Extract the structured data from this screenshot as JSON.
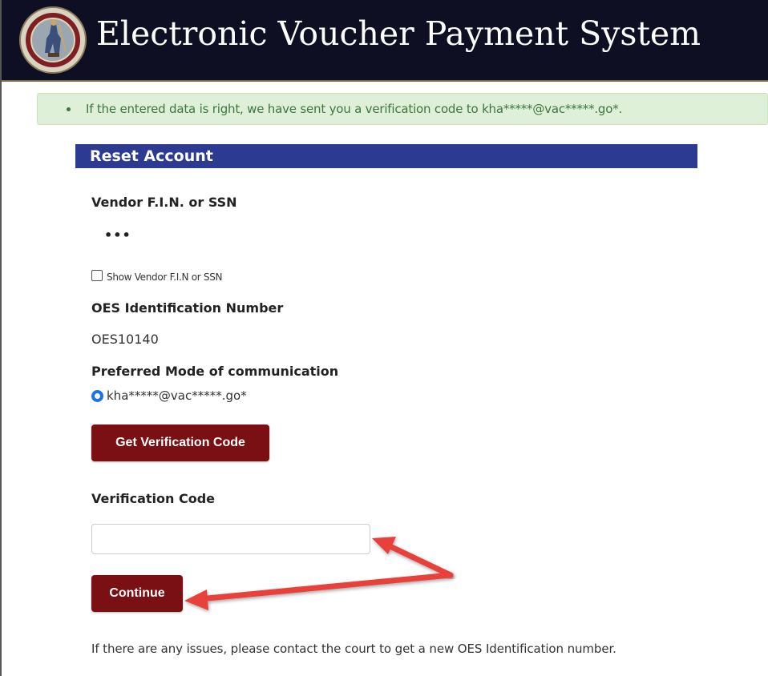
{
  "header": {
    "title": "Electronic Voucher Payment System",
    "logo_icon": "virginia-state-seal"
  },
  "alert": {
    "message": "If the entered data is right, we have sent you a verification code to kha*****@vac*****.go*.",
    "type": "success",
    "close_icon": "close-x-icon"
  },
  "panel": {
    "title": "Reset Account"
  },
  "form": {
    "vendor_label": "Vendor F.I.N. or SSN",
    "vendor_value_masked": "•••",
    "show_vendor_checkbox_label": "Show Vendor F.I.N or SSN",
    "show_vendor_checked": false,
    "oes_label": "OES Identification Number",
    "oes_value": "OES10140",
    "comm_label": "Preferred Mode of communication",
    "comm_option": "kha*****@vac*****.go*",
    "comm_selected": true,
    "get_code_button": "Get Verification Code",
    "verification_label": "Verification Code",
    "verification_value": "",
    "continue_button": "Continue",
    "footer_note": "If there are any issues, please contact the court to get a new OES Identification number."
  },
  "colors": {
    "header_bg": "#0f0f24",
    "panel_header_bg": "#2d3a91",
    "button_bg": "#7a0f14",
    "alert_bg": "#dff0d8",
    "alert_text": "#3c763d",
    "arrow_color": "#e8403a",
    "radio_color": "#1a73e8"
  }
}
